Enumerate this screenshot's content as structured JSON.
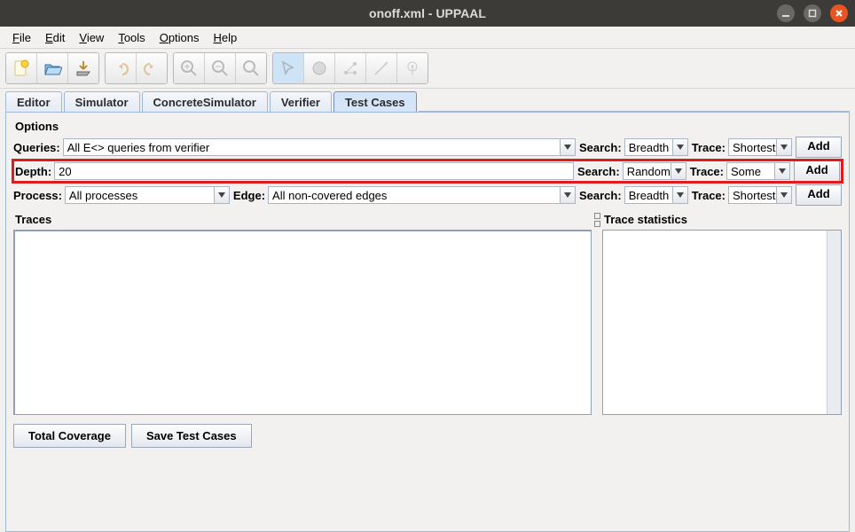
{
  "window": {
    "title": "onoff.xml - UPPAAL"
  },
  "menu": {
    "file": "File",
    "edit": "Edit",
    "view": "View",
    "tools": "Tools",
    "options": "Options",
    "help": "Help"
  },
  "tabs": {
    "editor": "Editor",
    "simulator": "Simulator",
    "concrete": "ConcreteSimulator",
    "verifier": "Verifier",
    "testcases": "Test Cases"
  },
  "options_title": "Options",
  "labels": {
    "queries": "Queries:",
    "depth": "Depth:",
    "process": "Process:",
    "edge": "Edge:",
    "search": "Search:",
    "trace": "Trace:",
    "add": "Add"
  },
  "row1": {
    "queries": "All E<> queries from verifier",
    "search": "Breadth",
    "trace": "Shortest"
  },
  "row2": {
    "depth": "20",
    "search": "Random",
    "trace": "Some"
  },
  "row3": {
    "process": "All processes",
    "edge": "All non-covered edges",
    "search": "Breadth",
    "trace": "Shortest"
  },
  "panels": {
    "traces": "Traces",
    "stats": "Trace statistics"
  },
  "buttons": {
    "coverage": "Total Coverage",
    "save": "Save Test Cases"
  }
}
